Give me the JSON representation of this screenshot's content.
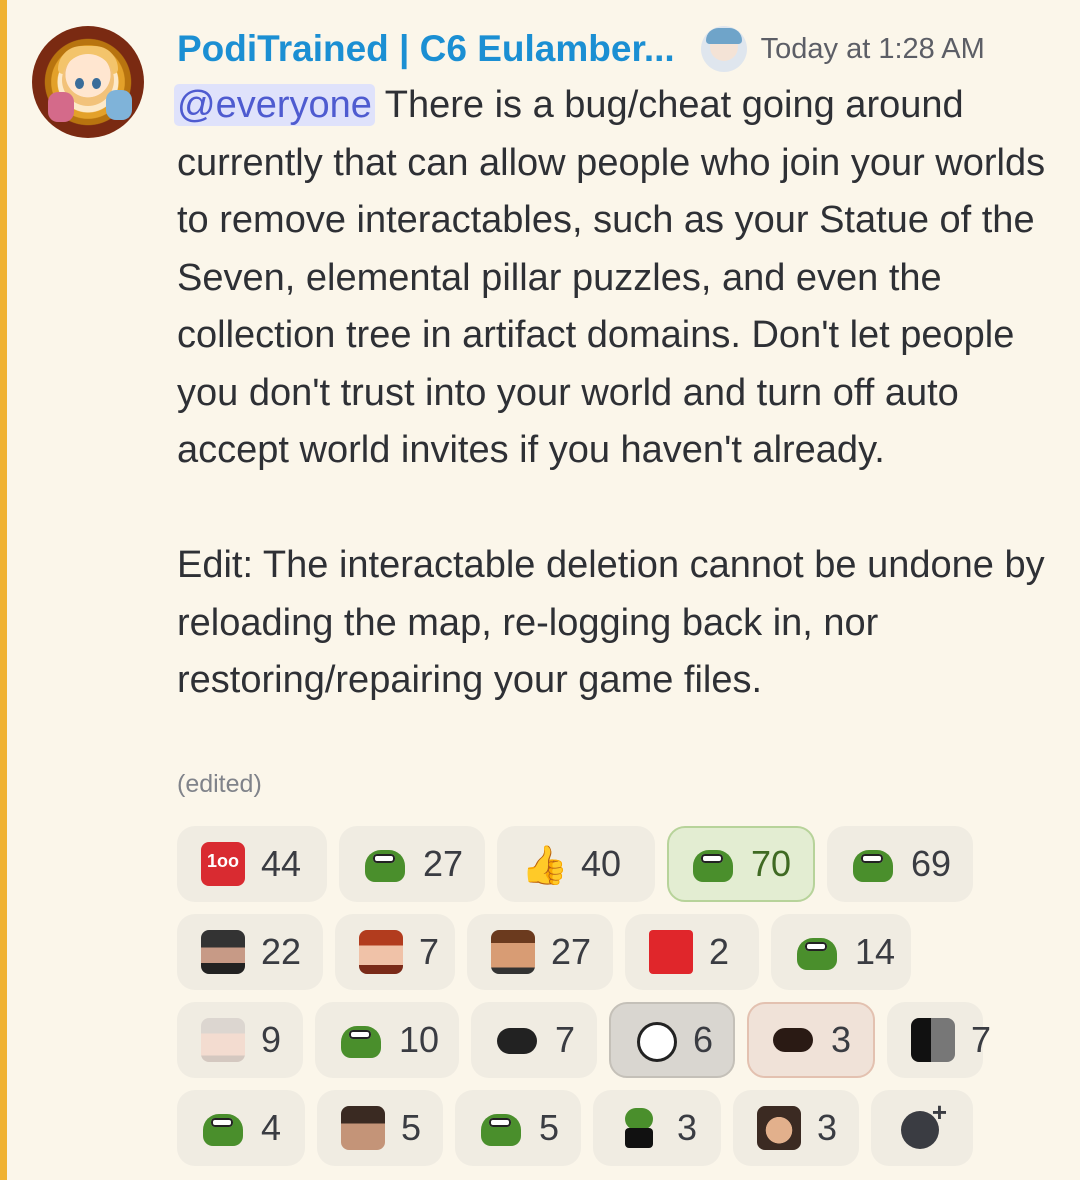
{
  "message": {
    "username": "PodiTrained | C6 Eulamber...",
    "timestamp": "Today at 1:28 AM",
    "mention": "@everyone",
    "paragraph1": " There is a bug/cheat going around currently that can allow people who join your worlds to remove interactables, such as your Statue of the Seven, elemental pillar puzzles, and even the collection tree in artifact domains. Don't let people you don't trust into your world and turn off auto accept world invites if you haven't already.",
    "paragraph2": "Edit: The interactable deletion cannot be undone by reloading the map, re-logging back in, nor restoring/repairing your game files.",
    "edited": "(edited)"
  },
  "colors": {
    "accent_bar": "#f0b232",
    "username": "#1b8fd3",
    "mention_bg": "#dfe2fb",
    "background": "#fbf6ea"
  },
  "reactions": [
    [
      {
        "emoji": "100-sticker",
        "count": "44"
      },
      {
        "emoji": "pepe-frog",
        "count": "27"
      },
      {
        "emoji": "thumbs-up",
        "count": "40"
      },
      {
        "emoji": "pepe-wide-eyes",
        "count": "70",
        "selected": true
      },
      {
        "emoji": "pepe-wide-eyes",
        "count": "69"
      }
    ],
    [
      {
        "emoji": "dark-hair-portrait",
        "count": "22"
      },
      {
        "emoji": "red-hair-portrait",
        "count": "7"
      },
      {
        "emoji": "laughing-man",
        "count": "27"
      },
      {
        "emoji": "red-square",
        "count": "2"
      },
      {
        "emoji": "pepe-frog",
        "count": "14"
      }
    ],
    [
      {
        "emoji": "pale-portrait",
        "count": "9"
      },
      {
        "emoji": "pepe-frog",
        "count": "10"
      },
      {
        "emoji": "dark-frog",
        "count": "7"
      },
      {
        "emoji": "trollface",
        "count": "6",
        "selected": true
      },
      {
        "emoji": "dark-face",
        "count": "3",
        "selected": true
      },
      {
        "emoji": "bw-meme",
        "count": "7"
      }
    ],
    [
      {
        "emoji": "pepe-frog",
        "count": "4"
      },
      {
        "emoji": "dark-photo",
        "count": "5"
      },
      {
        "emoji": "pepe-frog",
        "count": "5"
      },
      {
        "emoji": "pepe-suit",
        "count": "3"
      },
      {
        "emoji": "face-photo",
        "count": "3"
      }
    ]
  ],
  "add_reaction_icon": "add-reaction-icon"
}
